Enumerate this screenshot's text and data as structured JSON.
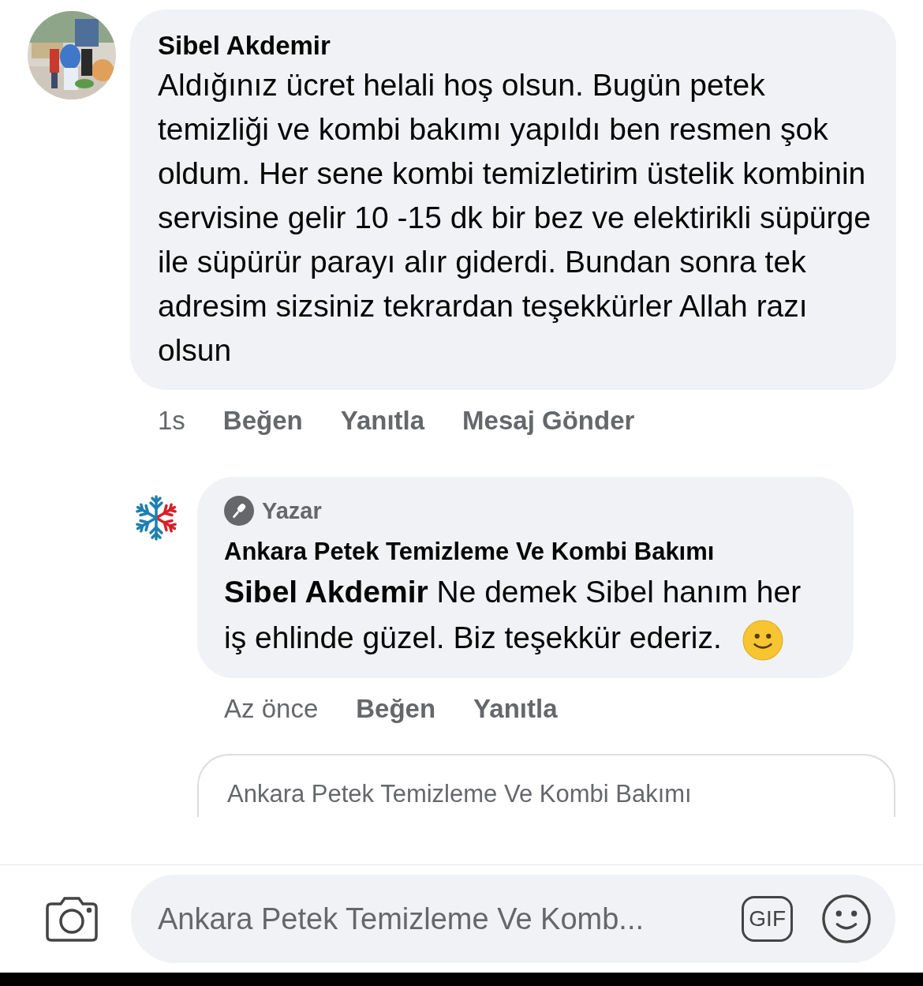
{
  "comments": [
    {
      "author": "Sibel Akdemir",
      "text": "Aldığınız ücret helali hoş olsun. Bugün petek temizliği ve kombi bakımı yapıldı ben resmen şok oldum. Her sene kombi temizletirim üstelik kombinin servisine gelir 10 -15 dk bir bez ve elektirikli süpürge ile süpürür parayı alır giderdi. Bundan sonra tek adresim sizsiniz tekrardan teşekkürler Allah razı olsun",
      "time": "1s",
      "actions": [
        "Beğen",
        "Yanıtla",
        "Mesaj Gönder"
      ]
    }
  ],
  "reply": {
    "badge": "Yazar",
    "author": "Ankara Petek Temizleme Ve Kombi Bakımı",
    "text": "**Sibel Akdemir** Ne demek Sibel hanım her iş ehlinde güzel. Biz teşekkür ederiz.",
    "time": "Az önce",
    "actions": [
      "Beğen",
      "Yanıtla"
    ]
  },
  "draft_card": {
    "text": "Ankara Petek Temizleme Ve Kombi Bakımı"
  },
  "composer": {
    "placeholder": "Ankara Petek Temizleme Ve Komb...",
    "gif": "GIF"
  }
}
